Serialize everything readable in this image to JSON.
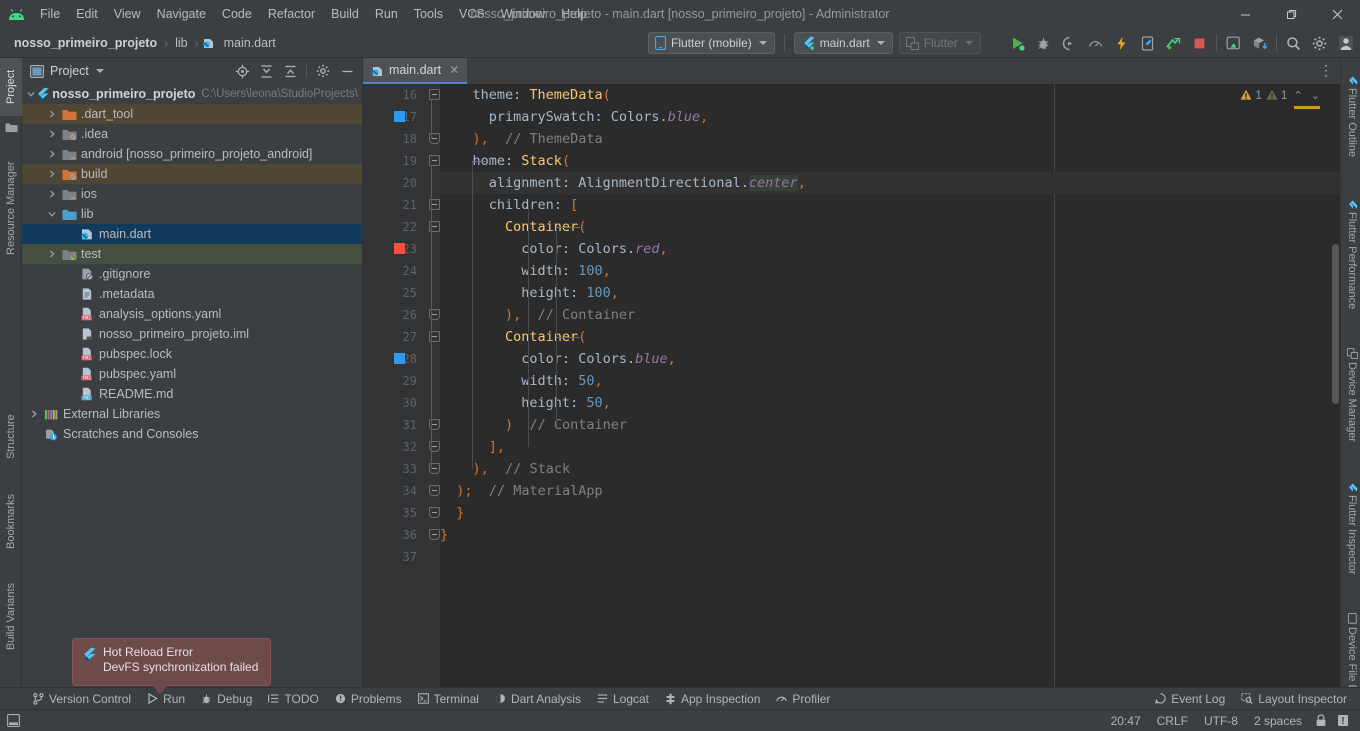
{
  "window": {
    "title": "nosso_primeiro_projeto - main.dart [nosso_primeiro_projeto] - Administrator",
    "minimize_label": "—",
    "maximize_label": "❐",
    "close_label": "✕"
  },
  "menu": {
    "items": [
      {
        "label": "File"
      },
      {
        "label": "Edit"
      },
      {
        "label": "View"
      },
      {
        "label": "Navigate"
      },
      {
        "label": "Code"
      },
      {
        "label": "Refactor"
      },
      {
        "label": "Build"
      },
      {
        "label": "Run"
      },
      {
        "label": "Tools"
      },
      {
        "label": "VCS"
      },
      {
        "label": "Window"
      },
      {
        "label": "Help"
      }
    ]
  },
  "breadcrumb": {
    "project": "nosso_primeiro_projeto",
    "folder": "lib",
    "file": "main.dart",
    "separator": "›"
  },
  "toolbar": {
    "device_selector": "Flutter (mobile)",
    "run_config": "main.dart",
    "flutter_dropdown": "Flutter",
    "actions": [
      {
        "name": "run-button",
        "title": "Run"
      },
      {
        "name": "debug-button",
        "title": "Debug"
      },
      {
        "name": "run-coverage-button",
        "title": "Run with Coverage"
      },
      {
        "name": "profile-button",
        "title": "Profile"
      },
      {
        "name": "hot-reload-button",
        "title": "Hot Reload"
      },
      {
        "name": "hot-restart-button",
        "title": "Hot Restart"
      },
      {
        "name": "open-devtools-button",
        "title": "Open DevTools"
      },
      {
        "name": "stop-button",
        "title": "Stop"
      },
      {
        "name": "device-preview-button",
        "title": "Device Preview"
      },
      {
        "name": "install-button",
        "title": "Install"
      },
      {
        "name": "search-everywhere-button",
        "title": "Search Everywhere"
      },
      {
        "name": "settings-button",
        "title": "Settings"
      },
      {
        "name": "account-avatar",
        "title": "Account"
      }
    ]
  },
  "left_strip": {
    "items": [
      {
        "label": "Project",
        "selected": true
      },
      {
        "label": "Resource Manager",
        "selected": false
      },
      {
        "label": "Structure",
        "selected": false
      },
      {
        "label": "Bookmarks",
        "selected": false
      },
      {
        "label": "Build Variants",
        "selected": false
      }
    ]
  },
  "right_strip": {
    "items": [
      {
        "label": "Flutter Outline"
      },
      {
        "label": "Flutter Performance"
      },
      {
        "label": "Device Manager"
      },
      {
        "label": "Flutter Inspector"
      },
      {
        "label": "Device File Explor"
      }
    ]
  },
  "project_panel": {
    "title": "Project",
    "icons": [
      {
        "name": "select-opened-file-icon",
        "title": "Select Opened File"
      },
      {
        "name": "expand-all-icon",
        "title": "Expand All"
      },
      {
        "name": "collapse-all-icon",
        "title": "Collapse All"
      },
      {
        "name": "panel-settings-icon",
        "title": "Options"
      },
      {
        "name": "hide-panel-icon",
        "title": "Hide"
      }
    ],
    "tree": [
      {
        "label": "nosso_primeiro_projeto",
        "path": "C:\\Users\\leona\\StudioProjects\\",
        "indent": 0,
        "arrow": "down",
        "icon": "flutter",
        "bold": true,
        "highlight": "none"
      },
      {
        "label": ".dart_tool",
        "indent": 1,
        "arrow": "right",
        "icon": "folder-orange",
        "highlight": "orange"
      },
      {
        "label": ".idea",
        "indent": 1,
        "arrow": "right",
        "icon": "folder-excluded",
        "highlight": "none"
      },
      {
        "label": "android [nosso_primeiro_projeto_android]",
        "indent": 1,
        "arrow": "right",
        "icon": "folder-module",
        "highlight": "none"
      },
      {
        "label": "build",
        "indent": 1,
        "arrow": "right",
        "icon": "folder-orange-excluded",
        "highlight": "orange"
      },
      {
        "label": "ios",
        "indent": 1,
        "arrow": "right",
        "icon": "folder-module",
        "highlight": "none"
      },
      {
        "label": "lib",
        "indent": 1,
        "arrow": "down",
        "icon": "folder-blue",
        "highlight": "none"
      },
      {
        "label": "main.dart",
        "indent": 2,
        "arrow": "none",
        "icon": "dart",
        "highlight": "selected"
      },
      {
        "label": "test",
        "indent": 1,
        "arrow": "right",
        "icon": "folder-test",
        "highlight": "green"
      },
      {
        "label": ".gitignore",
        "indent": 2,
        "arrow": "none",
        "icon": "file-ignore",
        "highlight": "none"
      },
      {
        "label": ".metadata",
        "indent": 2,
        "arrow": "none",
        "icon": "file-text",
        "highlight": "none"
      },
      {
        "label": "analysis_options.yaml",
        "indent": 2,
        "arrow": "none",
        "icon": "file-yaml",
        "highlight": "none"
      },
      {
        "label": "nosso_primeiro_projeto.iml",
        "indent": 2,
        "arrow": "none",
        "icon": "file-iml",
        "highlight": "none"
      },
      {
        "label": "pubspec.lock",
        "indent": 2,
        "arrow": "none",
        "icon": "file-yaml",
        "highlight": "none"
      },
      {
        "label": "pubspec.yaml",
        "indent": 2,
        "arrow": "none",
        "icon": "file-yaml",
        "highlight": "none"
      },
      {
        "label": "README.md",
        "indent": 2,
        "arrow": "none",
        "icon": "file-md",
        "highlight": "none"
      },
      {
        "label": "External Libraries",
        "indent": 0,
        "arrow": "right",
        "icon": "libraries",
        "highlight": "none"
      },
      {
        "label": "Scratches and Consoles",
        "indent": 0,
        "arrow": "none",
        "icon": "scratches",
        "highlight": "none"
      }
    ]
  },
  "editor": {
    "tab": {
      "label": "main.dart",
      "close": "✕"
    },
    "warnings": [
      {
        "count": "1",
        "severity": "warning"
      },
      {
        "count": "1",
        "severity": "weak-warning"
      }
    ],
    "nav_up": "⌃",
    "nav_down": "⌄",
    "caret_line": 20,
    "first_visible_line": 16,
    "lines": [
      {
        "n": 16,
        "fold": "collapse",
        "swatch": null,
        "tokens": [
          {
            "t": "    ",
            "c": "txt"
          },
          {
            "t": "theme",
            "c": "txt"
          },
          {
            "t": ": ",
            "c": "txt"
          },
          {
            "t": "ThemeData",
            "c": "cls"
          },
          {
            "t": "(",
            "c": "punc"
          }
        ]
      },
      {
        "n": 17,
        "fold": "none",
        "swatch": "#2e9bf0",
        "tokens": [
          {
            "t": "      ",
            "c": "txt"
          },
          {
            "t": "primarySwatch",
            "c": "txt"
          },
          {
            "t": ": ",
            "c": "txt"
          },
          {
            "t": "Colors",
            "c": "txt"
          },
          {
            "t": ".",
            "c": "txt"
          },
          {
            "t": "blue",
            "c": "ital"
          },
          {
            "t": ",",
            "c": "punc"
          }
        ]
      },
      {
        "n": 18,
        "fold": "end",
        "swatch": null,
        "tokens": [
          {
            "t": "    ",
            "c": "txt"
          },
          {
            "t": ")",
            "c": "punc"
          },
          {
            "t": ",",
            "c": "punc"
          },
          {
            "t": "  ",
            "c": "txt"
          },
          {
            "t": "// ThemeData",
            "c": "cmt"
          }
        ]
      },
      {
        "n": 19,
        "fold": "collapse",
        "swatch": null,
        "tokens": [
          {
            "t": "    ",
            "c": "txt"
          },
          {
            "t": "home",
            "c": "txt"
          },
          {
            "t": ": ",
            "c": "txt"
          },
          {
            "t": "Stack",
            "c": "cls"
          },
          {
            "t": "(",
            "c": "punc"
          }
        ]
      },
      {
        "n": 20,
        "fold": "none",
        "swatch": null,
        "tokens": [
          {
            "t": "      ",
            "c": "txt"
          },
          {
            "t": "alignment",
            "c": "txt"
          },
          {
            "t": ": ",
            "c": "txt"
          },
          {
            "t": "AlignmentDirectional",
            "c": "txt"
          },
          {
            "t": ".",
            "c": "txt"
          },
          {
            "t": "center",
            "c": "ital-hl"
          },
          {
            "t": ",",
            "c": "punc"
          }
        ]
      },
      {
        "n": 21,
        "fold": "collapse",
        "swatch": null,
        "tokens": [
          {
            "t": "      ",
            "c": "txt"
          },
          {
            "t": "children",
            "c": "txt"
          },
          {
            "t": ": ",
            "c": "txt"
          },
          {
            "t": "[",
            "c": "punc"
          }
        ]
      },
      {
        "n": 22,
        "fold": "collapse",
        "swatch": null,
        "tokens": [
          {
            "t": "        ",
            "c": "txt"
          },
          {
            "t": "Container",
            "c": "cls"
          },
          {
            "t": "(",
            "c": "punc"
          }
        ]
      },
      {
        "n": 23,
        "fold": "none",
        "swatch": "#f4503c",
        "tokens": [
          {
            "t": "          ",
            "c": "txt"
          },
          {
            "t": "color",
            "c": "txt"
          },
          {
            "t": ": ",
            "c": "txt"
          },
          {
            "t": "Colors",
            "c": "txt"
          },
          {
            "t": ".",
            "c": "txt"
          },
          {
            "t": "red",
            "c": "ital"
          },
          {
            "t": ",",
            "c": "punc"
          }
        ]
      },
      {
        "n": 24,
        "fold": "none",
        "swatch": null,
        "tokens": [
          {
            "t": "          ",
            "c": "txt"
          },
          {
            "t": "width",
            "c": "txt"
          },
          {
            "t": ": ",
            "c": "txt"
          },
          {
            "t": "100",
            "c": "num"
          },
          {
            "t": ",",
            "c": "punc"
          }
        ]
      },
      {
        "n": 25,
        "fold": "none",
        "swatch": null,
        "tokens": [
          {
            "t": "          ",
            "c": "txt"
          },
          {
            "t": "height",
            "c": "txt"
          },
          {
            "t": ": ",
            "c": "txt"
          },
          {
            "t": "100",
            "c": "num"
          },
          {
            "t": ",",
            "c": "punc"
          }
        ]
      },
      {
        "n": 26,
        "fold": "end",
        "swatch": null,
        "tokens": [
          {
            "t": "        ",
            "c": "txt"
          },
          {
            "t": ")",
            "c": "punc"
          },
          {
            "t": ",",
            "c": "punc"
          },
          {
            "t": "  ",
            "c": "txt"
          },
          {
            "t": "// Container",
            "c": "cmt"
          }
        ]
      },
      {
        "n": 27,
        "fold": "collapse",
        "swatch": null,
        "tokens": [
          {
            "t": "        ",
            "c": "txt"
          },
          {
            "t": "Container",
            "c": "cls"
          },
          {
            "t": "(",
            "c": "punc"
          }
        ]
      },
      {
        "n": 28,
        "fold": "none",
        "swatch": "#2e9bf0",
        "tokens": [
          {
            "t": "          ",
            "c": "txt"
          },
          {
            "t": "color",
            "c": "txt"
          },
          {
            "t": ": ",
            "c": "txt"
          },
          {
            "t": "Colors",
            "c": "txt"
          },
          {
            "t": ".",
            "c": "txt"
          },
          {
            "t": "blue",
            "c": "ital"
          },
          {
            "t": ",",
            "c": "punc"
          }
        ]
      },
      {
        "n": 29,
        "fold": "none",
        "swatch": null,
        "tokens": [
          {
            "t": "          ",
            "c": "txt"
          },
          {
            "t": "width",
            "c": "txt"
          },
          {
            "t": ": ",
            "c": "txt"
          },
          {
            "t": "50",
            "c": "num"
          },
          {
            "t": ",",
            "c": "punc"
          }
        ]
      },
      {
        "n": 30,
        "fold": "none",
        "swatch": null,
        "tokens": [
          {
            "t": "          ",
            "c": "txt"
          },
          {
            "t": "height",
            "c": "txt"
          },
          {
            "t": ": ",
            "c": "txt"
          },
          {
            "t": "50",
            "c": "num"
          },
          {
            "t": ",",
            "c": "punc"
          }
        ]
      },
      {
        "n": 31,
        "fold": "end",
        "swatch": null,
        "tokens": [
          {
            "t": "        ",
            "c": "txt"
          },
          {
            "t": ")",
            "c": "punc"
          },
          {
            "t": "  ",
            "c": "txt"
          },
          {
            "t": "// Container",
            "c": "cmt"
          }
        ]
      },
      {
        "n": 32,
        "fold": "end",
        "swatch": null,
        "tokens": [
          {
            "t": "      ",
            "c": "txt"
          },
          {
            "t": "]",
            "c": "punc"
          },
          {
            "t": ",",
            "c": "punc"
          }
        ]
      },
      {
        "n": 33,
        "fold": "end",
        "swatch": null,
        "tokens": [
          {
            "t": "    ",
            "c": "txt"
          },
          {
            "t": ")",
            "c": "punc"
          },
          {
            "t": ",",
            "c": "punc"
          },
          {
            "t": "  ",
            "c": "txt"
          },
          {
            "t": "// Stack",
            "c": "cmt"
          }
        ]
      },
      {
        "n": 34,
        "fold": "end",
        "swatch": null,
        "tokens": [
          {
            "t": "  ",
            "c": "txt"
          },
          {
            "t": ")",
            "c": "punc"
          },
          {
            "t": ";",
            "c": "punc"
          },
          {
            "t": "  ",
            "c": "txt"
          },
          {
            "t": "// MaterialApp",
            "c": "cmt"
          }
        ]
      },
      {
        "n": 35,
        "fold": "end",
        "swatch": null,
        "tokens": [
          {
            "t": "  ",
            "c": "txt"
          },
          {
            "t": "}",
            "c": "punc"
          }
        ]
      },
      {
        "n": 36,
        "fold": "end",
        "swatch": null,
        "tokens": [
          {
            "t": "}",
            "c": "punc"
          }
        ]
      },
      {
        "n": 37,
        "fold": "none",
        "swatch": null,
        "tokens": []
      }
    ]
  },
  "notification": {
    "title": "Hot Reload Error",
    "message": "DevFS synchronization failed",
    "icon": "flutter-icon"
  },
  "bottom_bar": {
    "items": [
      {
        "label": "Version Control",
        "icon": "branch-icon"
      },
      {
        "label": "Run",
        "icon": "play-icon"
      },
      {
        "label": "Debug",
        "icon": "bug-icon"
      },
      {
        "label": "TODO",
        "icon": "list-icon"
      },
      {
        "label": "Problems",
        "icon": "problems-icon"
      },
      {
        "label": "Terminal",
        "icon": "terminal-icon"
      },
      {
        "label": "Dart Analysis",
        "icon": "dart-icon"
      },
      {
        "label": "Logcat",
        "icon": "logcat-icon"
      },
      {
        "label": "App Inspection",
        "icon": "inspection-icon"
      },
      {
        "label": "Profiler",
        "icon": "profiler-icon"
      }
    ],
    "right_items": [
      {
        "label": "Event Log",
        "icon": "event-log-icon"
      },
      {
        "label": "Layout Inspector",
        "icon": "layout-inspector-icon"
      }
    ]
  },
  "status_bar": {
    "position": "20:47",
    "line_separator": "CRLF",
    "encoding": "UTF-8",
    "indent": "2 spaces",
    "lock_icon": "lock-icon",
    "notification_icon": "notification-icon"
  },
  "colors": {
    "accent_blue": "#4a88c7",
    "selection_blue": "#123a5c",
    "panel_bg": "#3c3f41",
    "editor_bg": "#2b2b2b",
    "gutter_bg": "#313335",
    "error_balloon": "#6e4b4b"
  }
}
